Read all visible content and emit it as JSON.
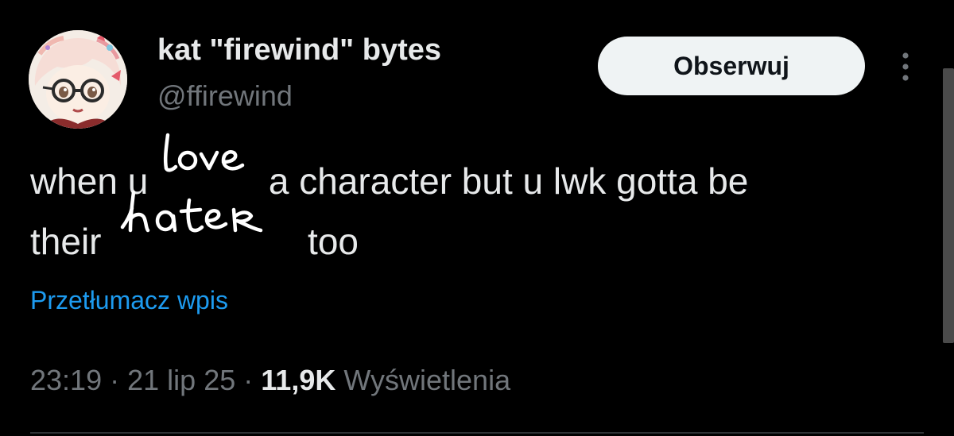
{
  "author": {
    "display_name": "kat \"firewind\" bytes",
    "handle": "@ffirewind"
  },
  "follow_button": {
    "label": "Obserwuj"
  },
  "more_icon": "more-vertical-icon",
  "tweet": {
    "line1_start": "when u ",
    "line1_hand_word": "love",
    "line1_end": " a character but u lwk gotta be",
    "line2_start": "their ",
    "line2_hand_word": "hater",
    "line2_end": " too"
  },
  "translate_link": "Przetłumacz wpis",
  "meta": {
    "time": "23:19",
    "separator": "·",
    "date": "21 lip 25",
    "views_count": "11,9K",
    "views_label": "Wyświetlenia"
  },
  "colors": {
    "background": "#000000",
    "text_primary": "#e7e9ea",
    "text_secondary": "#71767b",
    "link": "#1d9bf0",
    "button_bg": "#eff3f4"
  }
}
